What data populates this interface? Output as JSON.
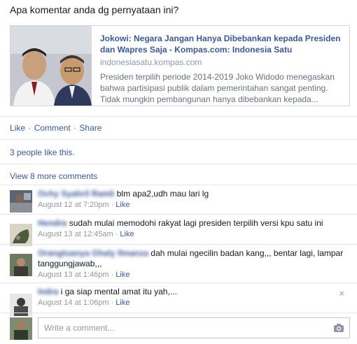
{
  "post": {
    "text": "Apa komentar anda dg pernyataan ini?"
  },
  "link": {
    "title": "Jokowi: Negara Jangan Hanya Dibebankan kepada Presiden dan Wapres Saja - Kompas.com: Indonesia Satu",
    "domain": "indonesiasatu.kompas.com",
    "description": "Presiden terpilih periode 2014-2019 Joko Widodo menegaskan bahwa partisipasi publik dalam pemerintahan sangat penting. Tidak mungkin pembangunan hanya dibebankan kepada..."
  },
  "actions": {
    "like": "Like",
    "comment": "Comment",
    "share": "Share",
    "separator": "·"
  },
  "likes_text": "3 people like this.",
  "view_more": "View 8 more comments",
  "comments": [
    {
      "author_blurred": "Ochy Syahril Ramli",
      "text": "blm apa2,udh mau lari lg",
      "time": "August 12 at 7:20pm",
      "like": "Like"
    },
    {
      "author_blurred": "Hendra",
      "text": "sudah mulai memodohi rakyat lagi presiden terpilih versi kpu satu ini",
      "time": "August 13 at 12:45am",
      "like": "Like"
    },
    {
      "author_blurred": "Orangtuanya Ghaly Ilmanza",
      "text": "dah mulai ngecilin badan kang,,, bentar lagi, lampar tanggungjawab,,,",
      "time": "August 13 at 1:46pm",
      "like": "Like"
    },
    {
      "author_blurred": "Indra",
      "text": "i ga siap mental amat itu yah,...",
      "time": "August 14 at 1:06pm",
      "like": "Like",
      "close": "×"
    }
  ],
  "composer": {
    "placeholder": "Write a comment..."
  },
  "meta_separator": " · ",
  "colors": {
    "link_blue": "#3b5998",
    "meta_gray": "#9197a3",
    "border": "#d3d6db"
  },
  "icons": [
    "camera-icon",
    "close-icon"
  ]
}
